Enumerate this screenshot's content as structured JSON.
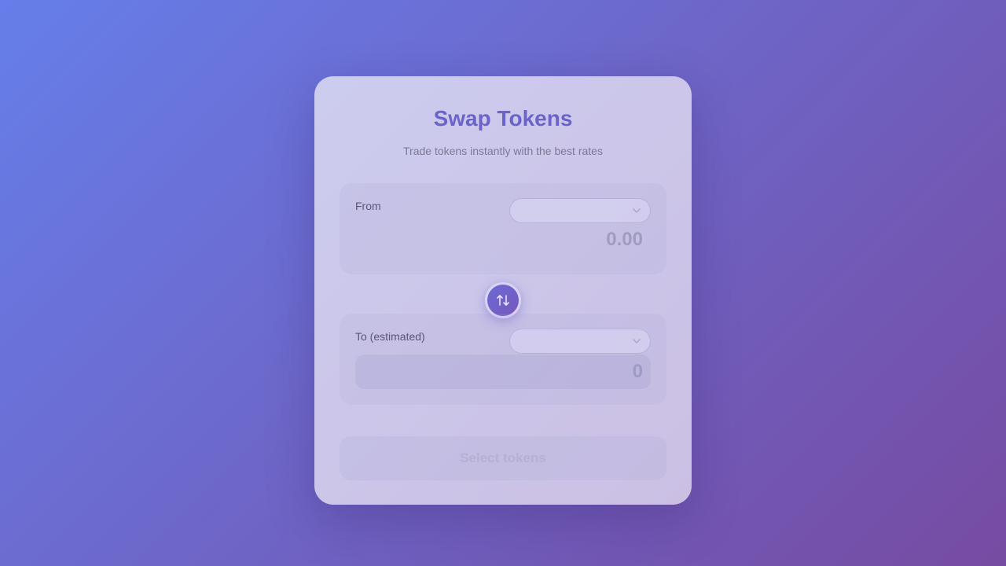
{
  "header": {
    "title": "Swap Tokens",
    "subtitle": "Trade tokens instantly with the best rates"
  },
  "from_panel": {
    "label": "From",
    "token_selected": "",
    "amount_placeholder": "0.00",
    "dropdown_icon": "chevron-down-icon"
  },
  "swap_button": {
    "icon": "swap-arrows-icon"
  },
  "to_panel": {
    "label": "To (estimated)",
    "token_selected": "",
    "amount": "0",
    "dropdown_icon": "chevron-down-icon"
  },
  "submit": {
    "label": "Select tokens"
  },
  "colors": {
    "accent": "#6a63c9",
    "background_start": "#667eea",
    "background_end": "#764ba2"
  }
}
